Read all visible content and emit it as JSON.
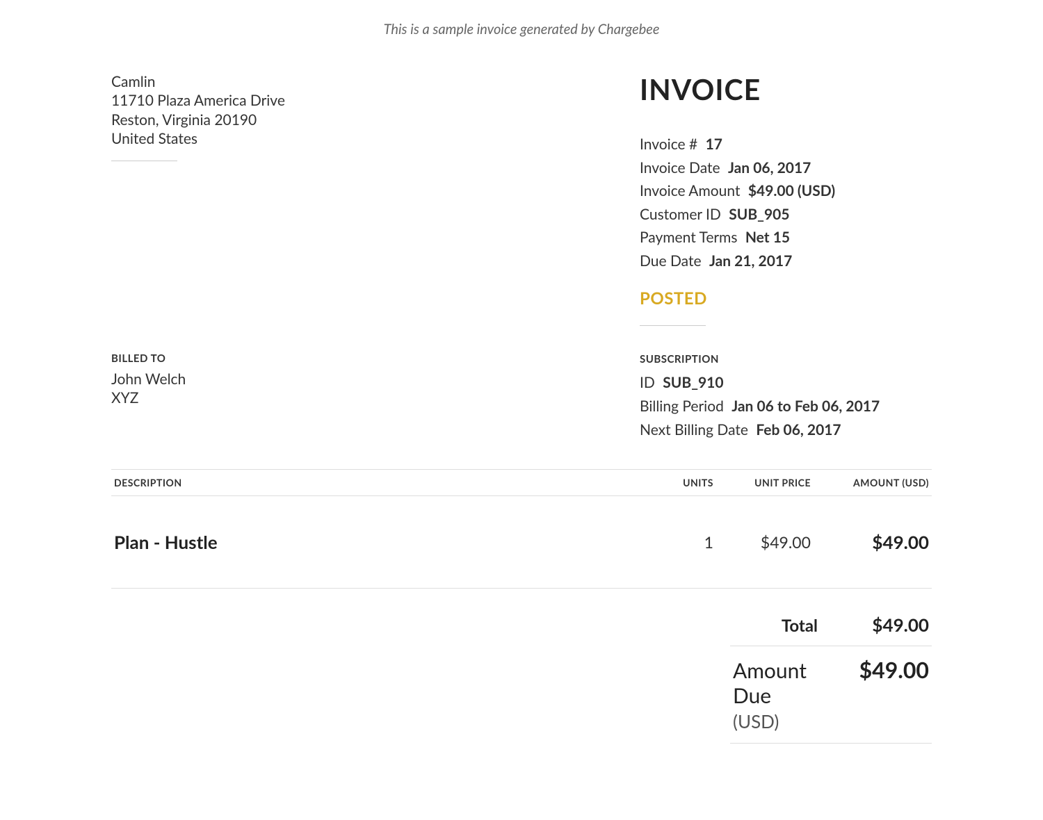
{
  "sample_note": "This is a sample invoice generated by Chargebee",
  "from": {
    "name": "Camlin",
    "street": "11710 Plaza America Drive",
    "city_state_zip": "Reston, Virginia 20190",
    "country": "United States"
  },
  "title": "INVOICE",
  "invoice": {
    "number_label": "Invoice #",
    "number": "17",
    "date_label": "Invoice Date",
    "date": "Jan 06, 2017",
    "amount_label": "Invoice Amount",
    "amount": "$49.00 (USD)",
    "customer_id_label": "Customer ID",
    "customer_id": "SUB_905",
    "terms_label": "Payment Terms",
    "terms": "Net 15",
    "due_date_label": "Due Date",
    "due_date": "Jan 21, 2017",
    "status": "POSTED"
  },
  "billed_to": {
    "heading": "BILLED TO",
    "name": "John Welch",
    "company": "XYZ"
  },
  "subscription": {
    "heading": "SUBSCRIPTION",
    "id_label": "ID",
    "id": "SUB_910",
    "period_label": "Billing Period",
    "period": "Jan 06 to Feb 06, 2017",
    "next_label": "Next Billing Date",
    "next": "Feb 06, 2017"
  },
  "table": {
    "headers": {
      "description": "DESCRIPTION",
      "units": "UNITS",
      "unit_price": "UNIT PRICE",
      "amount": "AMOUNT (USD)"
    },
    "rows": [
      {
        "description": "Plan - Hustle",
        "units": "1",
        "unit_price": "$49.00",
        "amount": "$49.00"
      }
    ]
  },
  "totals": {
    "total_label": "Total",
    "total_value": "$49.00",
    "due_label": "Amount Due",
    "due_currency": "(USD)",
    "due_value": "$49.00"
  }
}
